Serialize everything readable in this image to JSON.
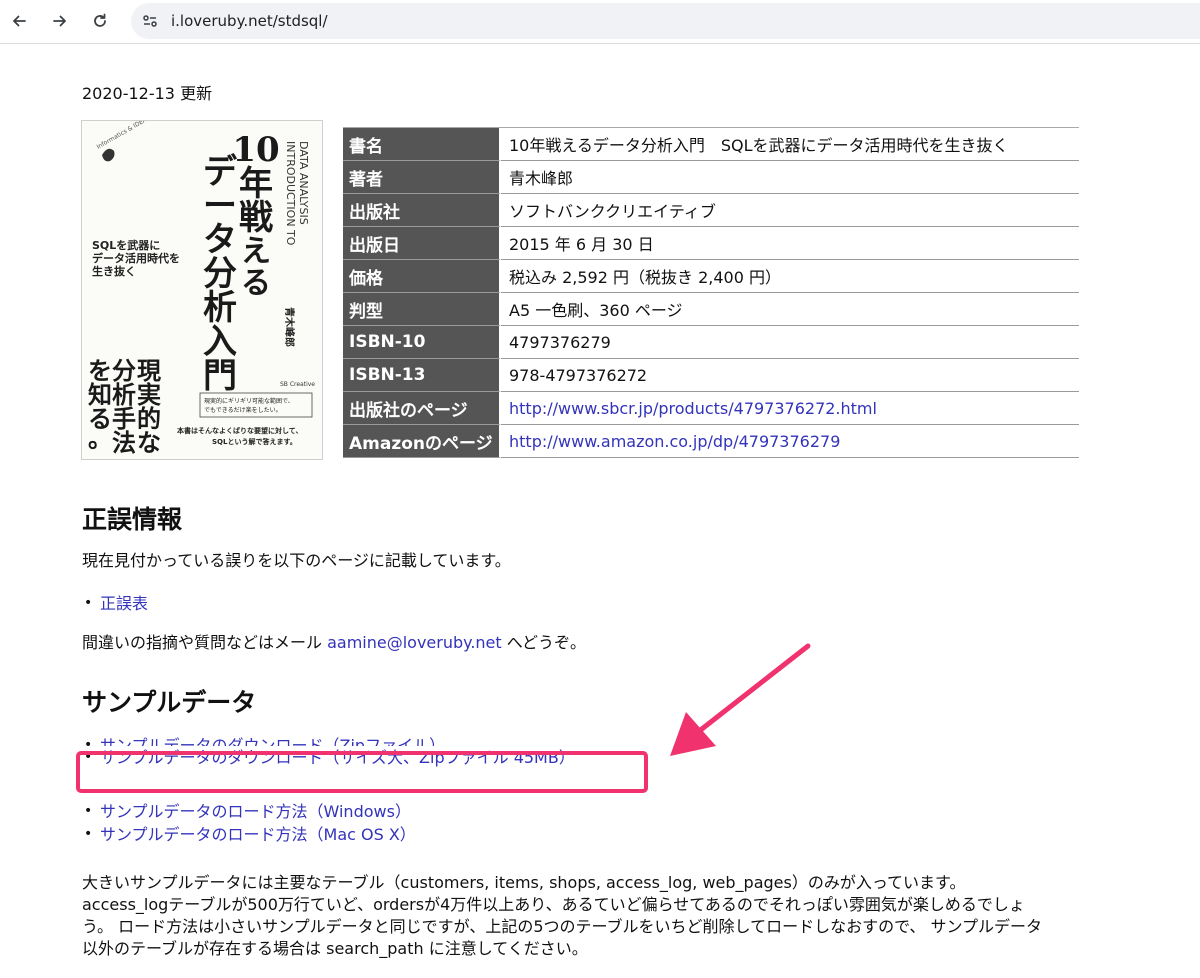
{
  "browser": {
    "url": "i.loveruby.net/stdsql/",
    "back_icon": "arrow-left-icon",
    "forward_icon": "arrow-right-icon",
    "reload_icon": "reload-icon",
    "site_info_icon": "tune-icon"
  },
  "page": {
    "updated": "2020-12-13 更新",
    "cover": {
      "series": "Informatics & IDEA",
      "main_title_1": "10年戦える",
      "main_title_2": "データ分析入門",
      "en_title_1": "INTRODUCTION TO",
      "en_title_2": "DATA ANALYSIS",
      "tagline": "SQLを武器に\nデータ活用時代を\n生き抜く",
      "author": "青木峰郎",
      "author_en": "AOKI Mineo",
      "catch_1": "現実的な",
      "catch_2": "分析手法",
      "catch_3": "を知る。",
      "publisher": "SB Creative",
      "note_box": "現実的にギリギリ可能な範囲で、\nでもできるだけ楽をしたい。",
      "note_text": "本書はそんなよくばりな要望に対して、\nSQLという解で答えます。"
    },
    "book_info": [
      {
        "label": "書名",
        "value": "10年戦えるデータ分析入門　SQLを武器にデータ活用時代を生き抜く"
      },
      {
        "label": "著者",
        "value": "青木峰郎"
      },
      {
        "label": "出版社",
        "value": "ソフトバンククリエイティブ"
      },
      {
        "label": "出版日",
        "value": "2015 年 6 月 30 日"
      },
      {
        "label": "価格",
        "value": "税込み 2,592 円（税抜き 2,400 円）"
      },
      {
        "label": "判型",
        "value": "A5 一色刷、360 ページ"
      },
      {
        "label": "ISBN-10",
        "value": "4797376279"
      },
      {
        "label": "ISBN-13",
        "value": "978-4797376272"
      },
      {
        "label": "出版社のページ",
        "value": "http://www.sbcr.jp/products/4797376272.html"
      },
      {
        "label": "Amazonのページ",
        "value": "http://www.amazon.co.jp/dp/4797376279"
      }
    ],
    "errata": {
      "heading": "正誤情報",
      "intro": "現在見付かっている誤りを以下のページに記載しています。",
      "link": "正誤表",
      "contact_prefix": "間違いの指摘や質問などはメール ",
      "contact_email": "aamine@loveruby.net",
      "contact_suffix": " へどうぞ。"
    },
    "sample": {
      "heading": "サンプルデータ",
      "links": [
        "サンプルデータのダウンロード（Zipファイル）",
        "サンプルデータのダウンロード（サイズ大、Zipファイル 45MB）",
        "サンプルデータのロード方法（Windows）",
        "サンプルデータのロード方法（Mac OS X）"
      ],
      "description": [
        "大きいサンプルデータには主要なテーブル（customers, items, shops, access_log, web_pages）のみが入っています。",
        "access_logテーブルが500万行ていど、ordersが4万件以上あり、あるていど偏らせてあるのでそれっぽい雰囲気が楽しめるでしょ",
        "う。 ロード方法は小さいサンプルデータと同じですが、上記の5つのテーブルをいちど削除してロードしなおすので、 サンプルデータ",
        "以外のテーブルが存在する場合は search_path に注意してください。"
      ]
    },
    "annotation": {
      "color": "#f0336f"
    }
  }
}
